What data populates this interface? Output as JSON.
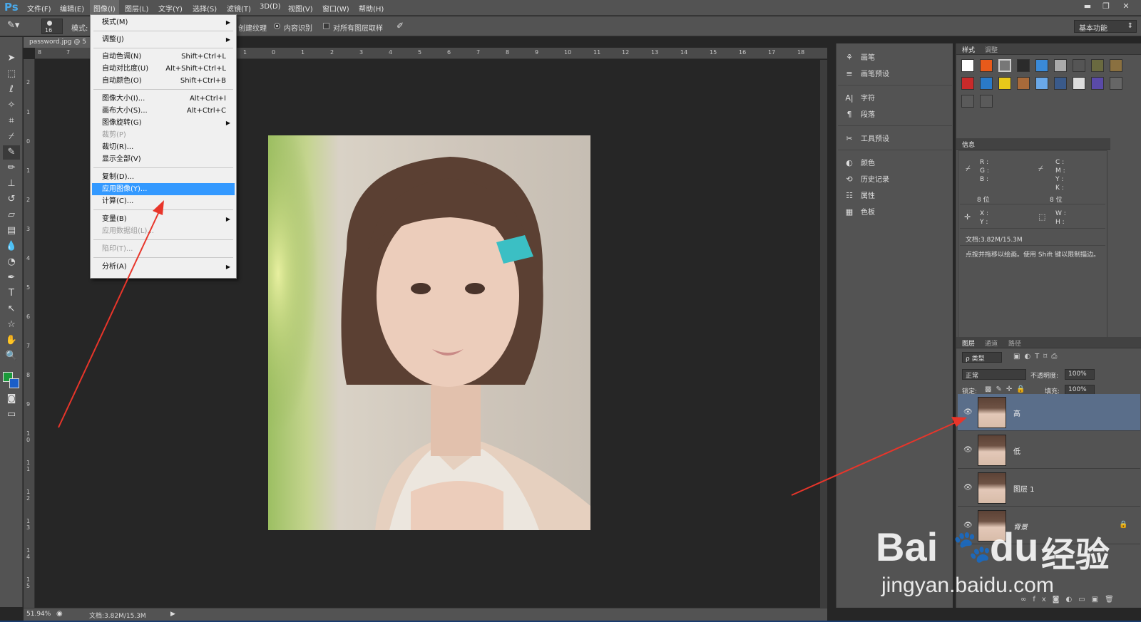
{
  "app": {
    "logo": "Ps"
  },
  "menubar": {
    "items": [
      "文件(F)",
      "编辑(E)",
      "图像(I)",
      "图层(L)",
      "文字(Y)",
      "选择(S)",
      "滤镜(T)",
      "3D(D)",
      "视图(V)",
      "窗口(W)",
      "帮助(H)"
    ],
    "active": "图像(I)"
  },
  "window_buttons": {
    "minimize": "▬",
    "restore": "❐",
    "close": "✕"
  },
  "options_bar": {
    "brush_size": "16",
    "mode_label": "模式:",
    "texture_label": "创建纹理",
    "content_aware_label": "内容识别",
    "sample_all_label": "对所有图层取样",
    "workspace": "基本功能"
  },
  "document": {
    "tab_title": "password.jpg @ 5",
    "zoom": "51.94%",
    "doc_size": "文档:3.82M/15.3M"
  },
  "ruler": {
    "top_ticks": [
      "8",
      "7",
      "1",
      "0",
      "1",
      "2",
      "3",
      "4",
      "5",
      "6",
      "7",
      "8",
      "9",
      "10",
      "11",
      "12",
      "13",
      "14",
      "15",
      "16",
      "17",
      "18"
    ],
    "left_ticks": [
      "2",
      "1",
      "0",
      "1",
      "2",
      "3",
      "4",
      "5",
      "6",
      "7",
      "8",
      "9",
      "1 0",
      "1 1",
      "1 2",
      "1 3",
      "1 4",
      "1 5"
    ]
  },
  "image_menu": {
    "items": [
      {
        "label": "模式(M)",
        "shortcut": "",
        "submenu": true,
        "disabled": false
      },
      {
        "label": "调整(J)",
        "shortcut": "",
        "submenu": true,
        "disabled": false
      },
      {
        "label": "自动色调(N)",
        "shortcut": "Shift+Ctrl+L",
        "submenu": false,
        "disabled": false
      },
      {
        "label": "自动对比度(U)",
        "shortcut": "Alt+Shift+Ctrl+L",
        "submenu": false,
        "disabled": false
      },
      {
        "label": "自动颜色(O)",
        "shortcut": "Shift+Ctrl+B",
        "submenu": false,
        "disabled": false
      },
      {
        "label": "图像大小(I)...",
        "shortcut": "Alt+Ctrl+I",
        "submenu": false,
        "disabled": false
      },
      {
        "label": "画布大小(S)...",
        "shortcut": "Alt+Ctrl+C",
        "submenu": false,
        "disabled": false
      },
      {
        "label": "图像旋转(G)",
        "shortcut": "",
        "submenu": true,
        "disabled": false
      },
      {
        "label": "裁剪(P)",
        "shortcut": "",
        "submenu": false,
        "disabled": true
      },
      {
        "label": "裁切(R)...",
        "shortcut": "",
        "submenu": false,
        "disabled": false
      },
      {
        "label": "显示全部(V)",
        "shortcut": "",
        "submenu": false,
        "disabled": false
      },
      {
        "label": "复制(D)...",
        "shortcut": "",
        "submenu": false,
        "disabled": false
      },
      {
        "label": "应用图像(Y)...",
        "shortcut": "",
        "submenu": false,
        "disabled": false,
        "highlighted": true
      },
      {
        "label": "计算(C)...",
        "shortcut": "",
        "submenu": false,
        "disabled": false
      },
      {
        "label": "变量(B)",
        "shortcut": "",
        "submenu": true,
        "disabled": false
      },
      {
        "label": "应用数据组(L)...",
        "shortcut": "",
        "submenu": false,
        "disabled": true
      },
      {
        "label": "陷印(T)...",
        "shortcut": "",
        "submenu": false,
        "disabled": true
      },
      {
        "label": "分析(A)",
        "shortcut": "",
        "submenu": true,
        "disabled": false
      }
    ]
  },
  "collapsed_panels": [
    "画笔",
    "画笔预设",
    "字符",
    "段落",
    "工具预设",
    "颜色",
    "历史记录",
    "属性",
    "色板"
  ],
  "styles_panel": {
    "tabs": [
      "样式",
      "调整"
    ]
  },
  "info_panel": {
    "title": "信息",
    "rgb": "R :\nG :\nB :",
    "cmyk": "C :\nM :\nY :\nK :",
    "bit_left": "8 位",
    "bit_right": "8 位",
    "xy": "X :\nY :",
    "wh": "W :\nH :",
    "doc": "文档:3.82M/15.3M",
    "hint": "点按并拖移以绘画。使用 Shift 键以限制描边。"
  },
  "layers_panel": {
    "tabs": [
      "图层",
      "通道",
      "路径"
    ],
    "filter": "ρ 类型",
    "blend_mode": "正常",
    "opacity_label": "不透明度:",
    "opacity": "100%",
    "lock_label": "锁定:",
    "fill_label": "填充:",
    "fill": "100%",
    "layers": [
      "高",
      "低",
      "图层 1",
      "背景"
    ],
    "selected": "高"
  },
  "watermark": {
    "brand": "Bai",
    "brand2": "du",
    "cn": "经验",
    "url": "jingyan.baidu.com"
  },
  "colors": {
    "accent": "#3399ff",
    "panel": "#535353",
    "canvas": "#262626",
    "arrow": "#e8352a",
    "selected_layer": "#5a6e8a"
  }
}
